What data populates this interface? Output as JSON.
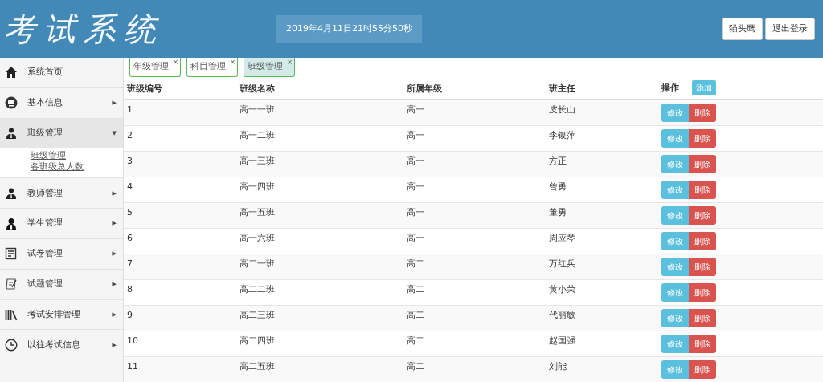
{
  "header": {
    "title": "考试系统",
    "datetime": "2019年4月11日21时55分50秒",
    "buttons": [
      "猫头鹰",
      "退出登录"
    ]
  },
  "sidebar": {
    "items": [
      {
        "label": "系统首页",
        "kind": "home",
        "expanded": false
      },
      {
        "label": "基本信息",
        "kind": "monitor",
        "arrow": "▶",
        "expanded": false
      },
      {
        "label": "班级管理",
        "kind": "group",
        "arrow": "▼",
        "expanded": true,
        "children": [
          {
            "label": "班级管理"
          },
          {
            "label": "各班级总人数"
          }
        ]
      },
      {
        "label": "教师管理",
        "kind": "group",
        "arrow": "▶",
        "expanded": false
      },
      {
        "label": "学生管理",
        "kind": "person",
        "arrow": "▶",
        "expanded": false
      },
      {
        "label": "试卷管理",
        "kind": "document",
        "arrow": "▶",
        "expanded": false
      },
      {
        "label": "试题管理",
        "kind": "paper",
        "arrow": "▶",
        "expanded": false
      },
      {
        "label": "考试安排管理",
        "kind": "books",
        "arrow": "▶",
        "expanded": false
      },
      {
        "label": "以往考试信息",
        "kind": "clock",
        "arrow": "▶",
        "expanded": false
      }
    ]
  },
  "tabs": [
    {
      "label": "年级管理",
      "close": "×",
      "selected": false
    },
    {
      "label": "科目管理",
      "close": "×",
      "selected": false
    },
    {
      "label": "班级管理",
      "close": "×",
      "selected": true
    }
  ],
  "table": {
    "columns": [
      "班级编号",
      "班级名称",
      "所属年级",
      "班主任",
      "操作"
    ],
    "add_button": "添加",
    "rows": [
      {
        "id": "1",
        "name": "高一一班",
        "grade": "高一",
        "teacher": "皮长山",
        "actions": [
          "修改",
          "删除"
        ]
      },
      {
        "id": "2",
        "name": "高一二班",
        "grade": "高一",
        "teacher": "李银萍",
        "actions": [
          "修改",
          "删除"
        ]
      },
      {
        "id": "3",
        "name": "高一三班",
        "grade": "高一",
        "teacher": "方正",
        "actions": [
          "修改",
          "删除"
        ]
      },
      {
        "id": "4",
        "name": "高一四班",
        "grade": "高一",
        "teacher": "曾勇",
        "actions": [
          "修改",
          "删除"
        ]
      },
      {
        "id": "5",
        "name": "高一五班",
        "grade": "高一",
        "teacher": "董勇",
        "actions": [
          "修改",
          "删除"
        ]
      },
      {
        "id": "6",
        "name": "高一六班",
        "grade": "高一",
        "teacher": "周应琴",
        "actions": [
          "修改",
          "删除"
        ]
      },
      {
        "id": "7",
        "name": "高二一班",
        "grade": "高二",
        "teacher": "万红兵",
        "actions": [
          "修改",
          "删除"
        ]
      },
      {
        "id": "8",
        "name": "高二二班",
        "grade": "高二",
        "teacher": "黄小荣",
        "actions": [
          "修改",
          "删除"
        ]
      },
      {
        "id": "9",
        "name": "高二三班",
        "grade": "高二",
        "teacher": "代丽敏",
        "actions": [
          "修改",
          "删除"
        ]
      },
      {
        "id": "10",
        "name": "高二四班",
        "grade": "高二",
        "teacher": "赵国强",
        "actions": [
          "修改",
          "删除"
        ]
      },
      {
        "id": "11",
        "name": "高二五班",
        "grade": "高二",
        "teacher": "刘能",
        "actions": [
          "修改",
          "删除"
        ]
      }
    ]
  }
}
